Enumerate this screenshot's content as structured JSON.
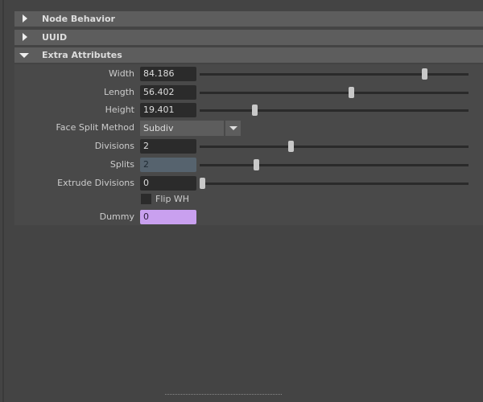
{
  "sections": [
    {
      "label": "Node Behavior",
      "expanded": false
    },
    {
      "label": "UUID",
      "expanded": false
    },
    {
      "label": "Extra Attributes",
      "expanded": true
    }
  ],
  "attributes": {
    "width": {
      "label": "Width",
      "value": "84.186",
      "slider": 0.835
    },
    "length": {
      "label": "Length",
      "value": "56.402",
      "slider": 0.563
    },
    "height": {
      "label": "Height",
      "value": "19.401",
      "slider": 0.204
    },
    "face_split": {
      "label": "Face Split Method",
      "value": "Subdiv"
    },
    "divisions": {
      "label": "Divisions",
      "value": "2",
      "slider": 0.338
    },
    "splits": {
      "label": "Splits",
      "value": "2",
      "slider": 0.21
    },
    "extrude": {
      "label": "Extrude Divisions",
      "value": "0",
      "slider": 0.0
    },
    "flip": {
      "label": "Flip WH",
      "checked": false
    },
    "dummy": {
      "label": "Dummy",
      "value": "0"
    }
  },
  "colors": {
    "splits_field": "#56636e",
    "dummy_field": "#c9a0ef"
  }
}
